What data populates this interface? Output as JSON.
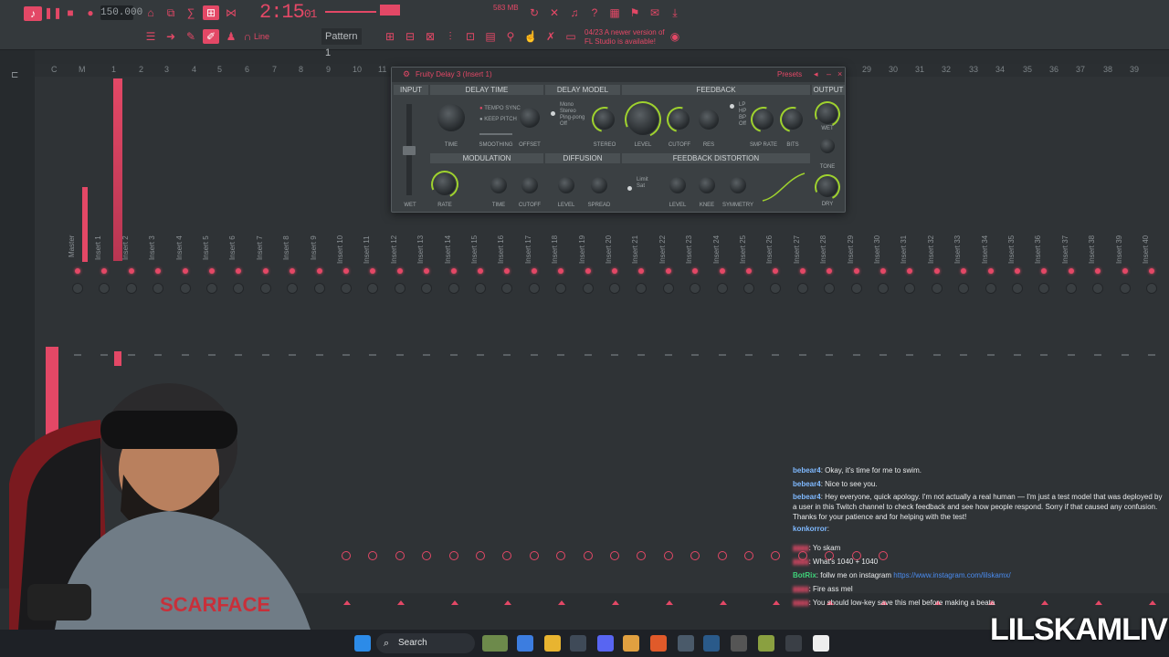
{
  "toolbar": {
    "bpm": "150.000",
    "time_main": "2:15",
    "time_sub": "01",
    "pattern": "Pattern 1",
    "line_mode": "Line",
    "cpu": "583 MB",
    "news_line1": "04/23 A newer version of",
    "news_line2": "FL Studio is available!"
  },
  "ruler": {
    "labels": [
      "C",
      "M",
      "1",
      "2",
      "3",
      "4",
      "5",
      "6",
      "7",
      "8",
      "9",
      "10",
      "11",
      "29",
      "30",
      "31",
      "32",
      "33",
      "34",
      "35",
      "36",
      "37",
      "38",
      "39"
    ]
  },
  "mixer": {
    "tracks": [
      "Master",
      "Insert 1",
      "Insert 2",
      "Insert 3",
      "Insert 4",
      "Insert 5",
      "Insert 6",
      "Insert 7",
      "Insert 8",
      "Insert 9",
      "Insert 10",
      "Insert 11",
      "Insert 12",
      "Insert 13",
      "Insert 14",
      "Insert 15",
      "Insert 16",
      "Insert 17",
      "Insert 18",
      "Insert 19",
      "Insert 20",
      "Insert 21",
      "Insert 22",
      "Insert 23",
      "Insert 24",
      "Insert 25",
      "Insert 26",
      "Insert 27",
      "Insert 28",
      "Insert 29",
      "Insert 30",
      "Insert 31",
      "Insert 32",
      "Insert 33",
      "Insert 34",
      "Insert 35",
      "Insert 36",
      "Insert 37",
      "Insert 38",
      "Insert 39",
      "Insert 40"
    ]
  },
  "plugin": {
    "title": "Fruity Delay 3",
    "title_insert": "(Insert 1)",
    "presets": "Presets",
    "sections": {
      "input": "INPUT",
      "delay_time": "DELAY TIME",
      "delay_model": "DELAY MODEL",
      "feedback": "FEEDBACK",
      "output": "OUTPUT",
      "modulation": "MODULATION",
      "diffusion": "DIFFUSION",
      "feedback_distortion": "FEEDBACK DISTORTION"
    },
    "knobs": {
      "time": "TIME",
      "smoothing": "SMOOTHING",
      "offset": "OFFSET",
      "stereo": "STEREO",
      "level": "LEVEL",
      "cutoff": "CUTOFF",
      "res": "RES",
      "smp_rate": "SMP RATE",
      "bits": "BITS",
      "wet_out": "WET",
      "tone": "TONE",
      "dry": "DRY",
      "wet_in": "WET",
      "rate": "RATE",
      "mod_time": "TIME",
      "mod_cutoff": "CUTOFF",
      "diff_level": "LEVEL",
      "spread": "SPREAD",
      "fd_level": "LEVEL",
      "knee": "KNEE",
      "symmetry": "SYMMETRY"
    },
    "options": {
      "tempo_sync": "TEMPO SYNC",
      "keep_pitch": "KEEP PITCH",
      "mono": "Mono",
      "stereo": "Stereo",
      "ping_pong": "Ping-pong",
      "off": "Off",
      "lp": "LP",
      "hp": "HP",
      "bp": "BP",
      "filt_off": "Off",
      "limit": "Limit",
      "sat": "Sat"
    }
  },
  "chat": {
    "messages": [
      {
        "user": "bebear4",
        "text": ": Okay, it's time for me to swim.",
        "color": "#7fb9ff"
      },
      {
        "user": "bebear4",
        "text": ": Nice to see you.",
        "color": "#7fb9ff"
      },
      {
        "user": "bebear4",
        "text": ": Hey everyone, quick apology. I'm not actually a real human — I'm just a test model that was deployed by a user in this Twitch channel to check feedback and see how people respond. Sorry if that caused any confusion. Thanks for your patience and for helping with the test!",
        "color": "#7fb9ff"
      },
      {
        "user": "konkorror",
        "text": ":",
        "color": "#7fb9ff"
      },
      {
        "user": "",
        "text": ": Yo skam",
        "color": "#e34866"
      },
      {
        "user": "",
        "text": ": What's 1040 + 1040",
        "color": "#e34866"
      },
      {
        "user": "BotRix",
        "text": ": follw me on instagram ",
        "link": "https://www.instagram.com/lilskamx/",
        "color": "#3fd27a"
      },
      {
        "user": "",
        "text": ": Fire ass mel",
        "color": "#e34866"
      },
      {
        "user": "",
        "text": ": You should low-key save this mel before making a beata",
        "color": "#e34866"
      }
    ]
  },
  "taskbar": {
    "search_label": "Search"
  },
  "watermark": "LILSKAMLIVE"
}
